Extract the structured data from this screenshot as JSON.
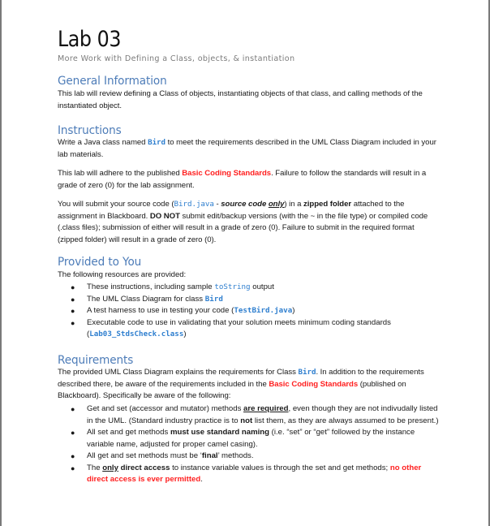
{
  "document": {
    "title": "Lab 03",
    "subtitle": "More Work with Defining a Class, objects, & instantiation",
    "colors": {
      "heading": "#4d7cb8",
      "code": "#2f7fcf",
      "emphasis_red": "#ff2020"
    }
  },
  "general": {
    "heading": "General Information",
    "body": "This lab will review defining a Class of objects, instantiating objects of that class, and calling methods of the instantiated object."
  },
  "instructions": {
    "heading": "Instructions",
    "p1": {
      "a": "Write a Java class named ",
      "code": "Bird",
      "b": " to meet the requirements described in the UML Class Diagram included in your lab materials."
    },
    "p2": {
      "a": "This lab will adhere to the published ",
      "red": "Basic Coding Standards",
      "b": ". Failure to follow the standards will result in a grade of zero (0) for the lab assignment."
    },
    "p3": {
      "a": "You will submit your source code (",
      "code": "Bird.java",
      "b": " - ",
      "bi1": "source code ",
      "bi2": "only",
      "c": ") in a ",
      "bold1": "zipped folder",
      "d": " attached to the assignment in Blackboard. ",
      "bold2": "DO NOT",
      "e": " submit edit/backup versions (with the ~ in the file type) or compiled code (.class files); submission of either will result in a grade of zero (0). Failure to submit in the required format (zipped folder) will result in a grade of zero (0)."
    }
  },
  "provided": {
    "heading": "Provided to You",
    "intro": "The following resources are provided:",
    "items": [
      {
        "a": "These instructions, including sample ",
        "code": "toString",
        "b": " output"
      },
      {
        "a": "The UML Class Diagram for class ",
        "code": "Bird",
        "b": ""
      },
      {
        "a": "A test harness to use in testing your code (",
        "code": "TestBird.java",
        "b": ")"
      },
      {
        "a": "Executable code to use in validating that your solution meets minimum coding standards (",
        "code": "Lab03_StdsCheck.class",
        "b": ")"
      }
    ]
  },
  "requirements": {
    "heading": "Requirements",
    "intro": {
      "a": "The provided UML Class Diagram explains the requirements for Class ",
      "code": "Bird",
      "b": ". In addition to the requirements described there, be aware of the requirements included in the ",
      "red": "Basic Coding Standards",
      "c": " (published on Blackboard). Specifically be aware of the following:"
    },
    "items": [
      {
        "a": "Get and set (accessor and mutator) methods ",
        "bu": "are required",
        "b": ", even though they are not indivudally listed in the UML. (Standard industry practice is to ",
        "bold": "not",
        "c": " list them, as they are always assumed to be present.)"
      },
      {
        "a": "All set and get methods ",
        "bold": "must use standard naming",
        "b": " (i.e. “set” or “get” followed by the instance variable name, adjusted for proper camel casing)."
      },
      {
        "a": "All get and set methods must be ‘",
        "bold": "final",
        "b": "’ methods."
      },
      {
        "a": "The ",
        "bu": "only",
        "sp": " ",
        "bold": "direct access",
        "b": " to instance variable values is through the set and get methods; ",
        "red": "no other direct access is ever permitted",
        "c": "."
      }
    ]
  }
}
